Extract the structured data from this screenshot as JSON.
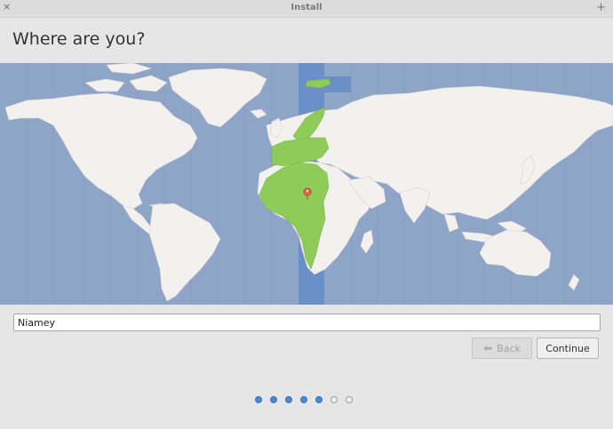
{
  "window": {
    "title": "Install",
    "close_glyph": "×",
    "maximize_glyph": "+"
  },
  "page": {
    "heading": "Where are you?"
  },
  "map": {
    "selected_city": "Niamey",
    "colors": {
      "ocean": "#8fa5c8",
      "land": "#f3f1ef",
      "selected_timezone_land": "#8fcb59",
      "selected_timezone_band": "#6d8fc7",
      "marker": "#e7664f"
    }
  },
  "location": {
    "value": "Niamey",
    "placeholder": ""
  },
  "buttons": {
    "back_label": "Back",
    "continue_label": "Continue"
  },
  "progress": {
    "total_steps": 7,
    "completed_steps": 5
  }
}
